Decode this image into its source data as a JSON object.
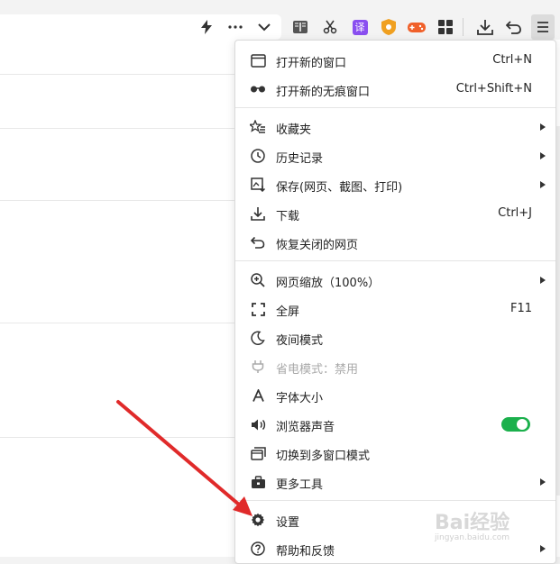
{
  "toolbar": {
    "icons": [
      "lightning-icon",
      "more-icon",
      "chevron-down-icon",
      "reader-icon",
      "scissors-icon",
      "translate-icon",
      "shield-icon",
      "game-icon",
      "apps-icon",
      "download-icon",
      "undo-icon",
      "menu-icon"
    ],
    "translate_label": "译"
  },
  "menu": {
    "new_window": {
      "label": "打开新的窗口",
      "shortcut": "Ctrl+N"
    },
    "new_incognito": {
      "label": "打开新的无痕窗口",
      "shortcut": "Ctrl+Shift+N"
    },
    "favorites": {
      "label": "收藏夹"
    },
    "history": {
      "label": "历史记录"
    },
    "save": {
      "label": "保存(网页、截图、打印)"
    },
    "download": {
      "label": "下载",
      "shortcut": "Ctrl+J"
    },
    "restore": {
      "label": "恢复关闭的网页"
    },
    "zoom": {
      "label": "网页缩放（100%）"
    },
    "fullscreen": {
      "label": "全屏",
      "shortcut": "F11"
    },
    "night_mode": {
      "label": "夜间模式"
    },
    "power_save": {
      "label": "省电模式：禁用"
    },
    "font_size": {
      "label": "字体大小"
    },
    "browser_sound": {
      "label": "浏览器声音",
      "enabled": true
    },
    "multi_window": {
      "label": "切换到多窗口模式"
    },
    "more_tools": {
      "label": "更多工具"
    },
    "settings": {
      "label": "设置"
    },
    "help": {
      "label": "帮助和反馈"
    }
  },
  "watermark": {
    "text": "Bai经验",
    "url": "jingyan.baidu.com"
  },
  "colors": {
    "accent_toggle": "#1bb04c",
    "annotation_arrow": "#e02a2a"
  }
}
